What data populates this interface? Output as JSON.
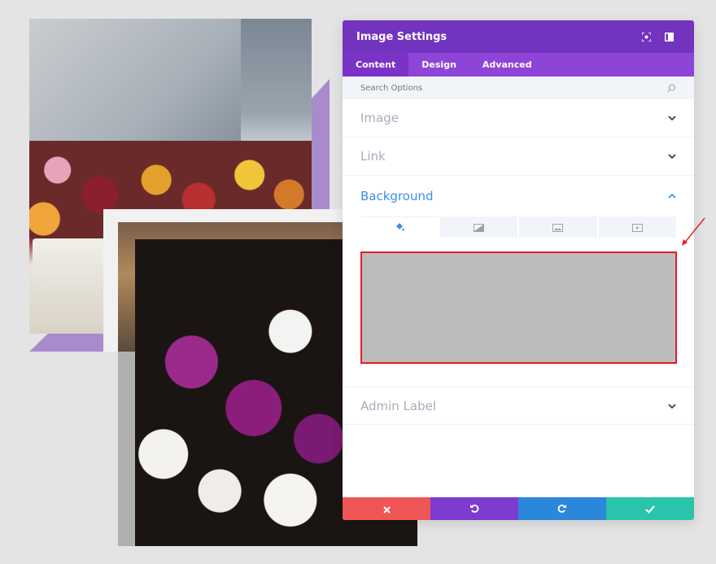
{
  "panel": {
    "title": "Image Settings",
    "tabs": [
      {
        "label": "Content",
        "active": true
      },
      {
        "label": "Design",
        "active": false
      },
      {
        "label": "Advanced",
        "active": false
      }
    ],
    "search_placeholder": "Search Options",
    "sections": {
      "image": "Image",
      "link": "Link",
      "background": "Background",
      "admin_label": "Admin Label"
    },
    "background_tabs": [
      "color-fill-icon",
      "gradient-icon",
      "image-icon",
      "video-icon"
    ],
    "background_color": "#bcbcbc"
  },
  "colors": {
    "header": "#7233be",
    "tabs_bar": "#8f44d8",
    "section_open": "#3c8fe3",
    "cancel": "#ef5555",
    "undo": "#7e3bd0",
    "redo": "#2b87da",
    "save": "#29c4a9",
    "highlight": "#e81c24"
  }
}
